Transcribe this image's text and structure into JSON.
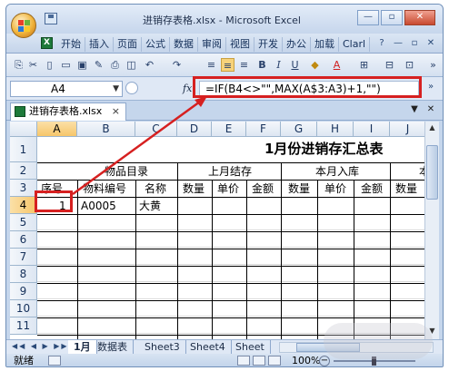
{
  "window": {
    "title": "进销存表格.xlsx - Microsoft Excel",
    "buttons": {
      "minimize": "—",
      "restore": "▫",
      "close": "✕"
    }
  },
  "menu": {
    "tabs": [
      "开始",
      "插入",
      "页面",
      "公式",
      "数据",
      "审阅",
      "视图",
      "开发",
      "办公",
      "加载",
      "Clarl"
    ]
  },
  "formula_bar": {
    "name_box": "A4",
    "fx_label": "fx",
    "formula": "=IF(B4<>\"\",MAX(A$3:A3)+1,\"\")"
  },
  "workbook": {
    "tab_label": "进销存表格.xlsx",
    "close": "×"
  },
  "grid": {
    "columns": [
      "A",
      "B",
      "C",
      "D",
      "E",
      "F",
      "G",
      "H",
      "I",
      "J"
    ],
    "selected_col": "A",
    "selected_row": "4",
    "rows": [
      "1",
      "2",
      "3",
      "4",
      "5",
      "6",
      "7",
      "8",
      "9",
      "10",
      "11"
    ],
    "title": "1月份进销存汇总表",
    "group_headers": {
      "goods": "物品目录",
      "prev_stock": "上月结存",
      "month_in": "本月入库",
      "trunc": "本"
    },
    "sub_headers": {
      "seq": "序号",
      "code": "物料编号",
      "name": "名称",
      "qty1": "数量",
      "price1": "单价",
      "amount1": "金额",
      "qty2": "数量",
      "price2": "单价",
      "amount2": "金额",
      "qty3": "数量"
    },
    "row4": {
      "a": "1",
      "b": "A0005",
      "c": "大黄"
    }
  },
  "sheets": {
    "nav": "◀◀ ◀ ▶ ▶▶",
    "tabs": [
      "1月",
      "数据表",
      "Sheet3",
      "Sheet4",
      "Sheet"
    ],
    "active": "1月"
  },
  "status": {
    "ready": "就绪",
    "zoom": "100%",
    "zoom_minus": "−"
  },
  "colors": {
    "annotation": "#d62020",
    "selection_header": "#f6c66a"
  }
}
